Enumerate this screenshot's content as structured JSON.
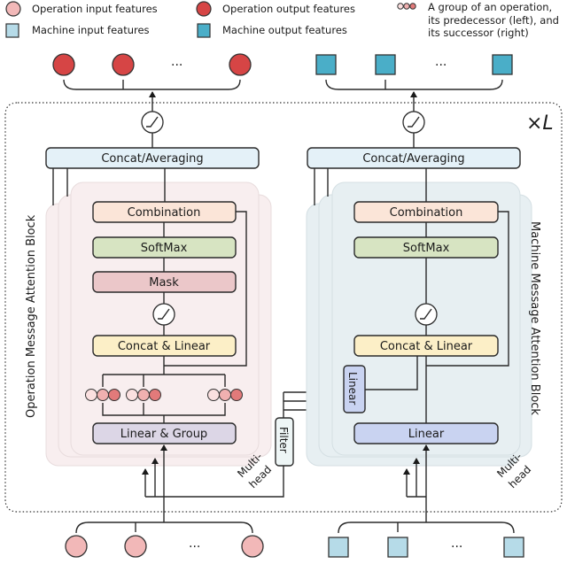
{
  "legend": {
    "op_input": "Operation input features",
    "op_output": "Operation output features",
    "group_line1": "A group of an operation,",
    "group_line2": "its predecessor (left), and",
    "group_line3": "its successor (right)",
    "mach_input": "Machine input features",
    "mach_output": "Machine output features"
  },
  "repeat_label": "×L",
  "ellipsis": "···",
  "left_block": {
    "title": "Operation Message Attention Block",
    "concat_avg": "Concat/Averaging",
    "combination": "Combination",
    "softmax": "SoftMax",
    "mask": "Mask",
    "concat_linear": "Concat & Linear",
    "linear_group": "Linear & Group",
    "multihead_1": "Multi-",
    "multihead_2": "head"
  },
  "right_block": {
    "title": "Machine Message Attention Block",
    "concat_avg": "Concat/Averaging",
    "combination": "Combination",
    "softmax": "SoftMax",
    "concat_linear": "Concat & Linear",
    "linear_small": "Linear",
    "linear": "Linear",
    "multihead_1": "Multi-",
    "multihead_2": "head"
  },
  "filter": "Filter",
  "colors": {
    "op_input": "#f2b8b8",
    "op_output": "#d64545",
    "mach_input": "#b6dbe8",
    "mach_output": "#4aaec8",
    "concat_avg": "#e4f1f8",
    "combination": "#fbe5d8",
    "softmax": "#d7e4c2",
    "mask": "#ebc7c9",
    "concat_linear": "#fcefc7",
    "linear_group": "#dcd6e6",
    "linear": "#c9d3f1",
    "left_panel": "#f8eeef",
    "right_panel": "#e7eff2"
  }
}
